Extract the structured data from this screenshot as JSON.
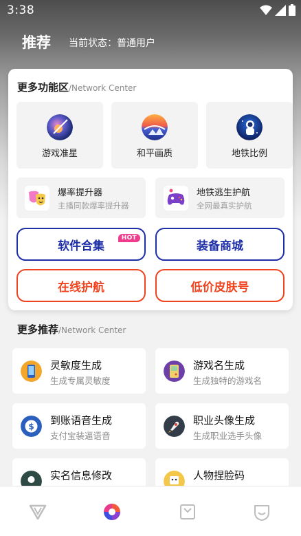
{
  "status_bar": {
    "time": "3:38"
  },
  "header": {
    "title": "推荐",
    "status_label": "当前状态：普通用户"
  },
  "more_features": {
    "title": "更多功能区",
    "subtitle": "/Network Center",
    "big_tiles": [
      {
        "label": "游戏准星",
        "icon": "crosshair-planet-icon"
      },
      {
        "label": "和平画质",
        "icon": "colorful-planet-icon"
      },
      {
        "label": "地铁比例",
        "icon": "astronaut-icon"
      }
    ],
    "wide_tiles": [
      {
        "title": "爆率提升器",
        "desc": "主播同款爆率提升器",
        "icon": "theater-masks-icon"
      },
      {
        "title": "地铁逃生护航",
        "desc": "全网最真实护航",
        "icon": "gamepad-icon"
      }
    ],
    "pills": [
      {
        "label": "软件合集",
        "badge": "HOT",
        "color": "#1e2fa8"
      },
      {
        "label": "装备商城",
        "color": "#1e2fa8"
      },
      {
        "label": "在线护航",
        "color": "#ee4420"
      },
      {
        "label": "低价皮肤号",
        "color": "#ee4420"
      }
    ]
  },
  "more_recommend": {
    "title": "更多推荐",
    "subtitle": "/Network Center",
    "items": [
      {
        "title": "灵敏度生成",
        "desc": "生成专属灵敏度",
        "icon": "phone-sensitivity-icon"
      },
      {
        "title": "游戏名生成",
        "desc": "生成独特的游戏名",
        "icon": "handheld-console-icon"
      },
      {
        "title": "到账语音生成",
        "desc": "支付宝装逼语音",
        "icon": "coin-voice-icon"
      },
      {
        "title": "职业头像生成",
        "desc": "生成职业选手头像",
        "icon": "rocket-avatar-icon"
      },
      {
        "title": "实名信息修改",
        "desc": "",
        "icon": "id-card-icon"
      },
      {
        "title": "人物捏脸码",
        "desc": "",
        "icon": "face-code-icon"
      }
    ]
  },
  "bottom_nav": {
    "items": [
      {
        "icon": "v-logo-icon"
      },
      {
        "icon": "recommend-circle-icon",
        "active": true
      },
      {
        "icon": "bag-icon"
      },
      {
        "icon": "profile-shield-icon"
      }
    ]
  },
  "colors": {
    "accent_blue": "#1e2fa8",
    "accent_red": "#ee4420",
    "hot_pink": "#f03c8c"
  }
}
